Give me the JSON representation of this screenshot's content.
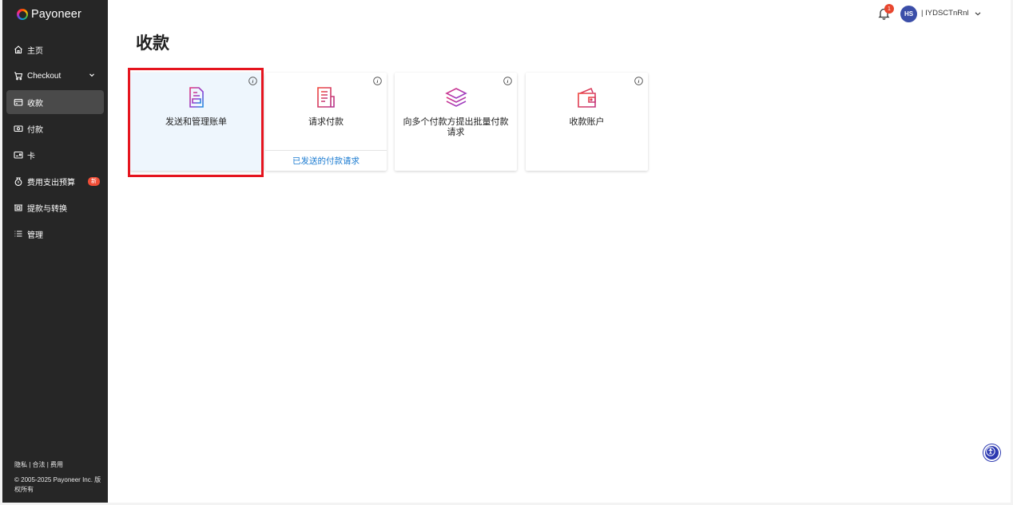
{
  "brand": {
    "name": "Payoneer"
  },
  "sidebar": {
    "items": [
      {
        "label": "主页",
        "icon": "home-icon"
      },
      {
        "label": "Checkout",
        "icon": "cart-icon"
      },
      {
        "label": "收款",
        "icon": "receive-icon",
        "active": true
      },
      {
        "label": "付款",
        "icon": "pay-icon"
      },
      {
        "label": "卡",
        "icon": "card-icon"
      },
      {
        "label": "费用支出预算",
        "icon": "budget-icon",
        "badge": "新"
      },
      {
        "label": "提款与转换",
        "icon": "withdraw-icon"
      },
      {
        "label": "管理",
        "icon": "list-icon"
      }
    ],
    "footer": {
      "links": "隐私 | 合法 | 费用",
      "copyright": "© 2005-2025 Payoneer Inc. 版权所有"
    }
  },
  "topbar": {
    "notification_count": "1",
    "avatar_initials": "HS",
    "user_name": "| IYDSCTnRnl"
  },
  "main": {
    "title": "收款",
    "cards": [
      {
        "label": "发送和管理账单",
        "icon": "invoice-icon",
        "selected": true
      },
      {
        "label": "请求付款",
        "icon": "request-icon",
        "link": "已发送的付款请求"
      },
      {
        "label": "向多个付款方提出批量付款请求",
        "icon": "layers-icon"
      },
      {
        "label": "收款账户",
        "icon": "wallet-icon"
      }
    ]
  },
  "colors": {
    "sidebar_bg": "#262626",
    "accent_link": "#1b7bd1",
    "highlight": "#e5141e",
    "selected_card": "#eef6fd"
  }
}
